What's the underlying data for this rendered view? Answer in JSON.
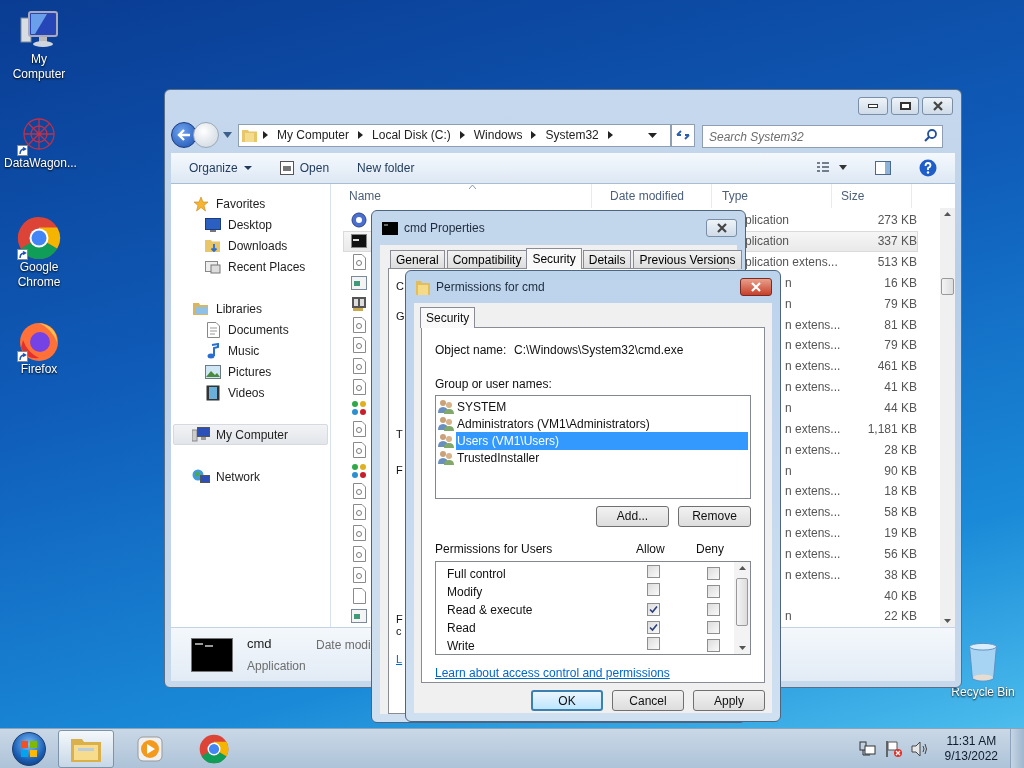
{
  "desktop_icons": [
    {
      "label": "My Computer",
      "kind": "computer",
      "shortcut": false
    },
    {
      "label": "DataWagon...",
      "kind": "datawagon",
      "shortcut": true
    },
    {
      "label": "Google Chrome",
      "kind": "chrome",
      "shortcut": true
    },
    {
      "label": "Firefox",
      "kind": "firefox",
      "shortcut": true
    },
    {
      "label": "Recycle Bin",
      "kind": "recycle",
      "shortcut": false
    }
  ],
  "explorer": {
    "breadcrumb": [
      "My Computer",
      "Local Disk (C:)",
      "Windows",
      "System32"
    ],
    "search": {
      "placeholder": "Search System32"
    },
    "toolbar": [
      {
        "label": "Organize",
        "kind": "menu"
      },
      {
        "label": "Open",
        "kind": "open"
      },
      {
        "label": "New folder",
        "kind": "plain"
      }
    ],
    "nav": [
      {
        "label": "Favorites",
        "selected": false,
        "children": [
          {
            "label": "Desktop",
            "selected": false
          },
          {
            "label": "Downloads",
            "selected": false
          },
          {
            "label": "Recent Places",
            "selected": false
          }
        ]
      },
      {
        "label": "Libraries",
        "selected": false,
        "children": [
          {
            "label": "Documents",
            "selected": false
          },
          {
            "label": "Music",
            "selected": false
          },
          {
            "label": "Pictures",
            "selected": false
          },
          {
            "label": "Videos",
            "selected": false
          }
        ]
      },
      {
        "label": "My Computer",
        "selected": true
      },
      {
        "label": "Network",
        "selected": false
      }
    ],
    "columns": [
      "Name",
      "Date modified",
      "Type",
      "Size"
    ],
    "rows": [
      {
        "kind": "globe",
        "type": "plication",
        "size": "273 KB",
        "selected": false
      },
      {
        "kind": "cmd",
        "type": "plication",
        "size": "337 KB",
        "selected": true
      },
      {
        "kind": "dll",
        "type": "plication extens...",
        "size": "513 KB",
        "selected": false
      },
      {
        "kind": "window",
        "type": "n",
        "size": "16 KB",
        "selected": false
      },
      {
        "kind": "book",
        "type": "n",
        "size": "79 KB",
        "selected": false
      },
      {
        "kind": "dll",
        "type": "n extens...",
        "size": "81 KB",
        "selected": false
      },
      {
        "kind": "dll",
        "type": "n extens...",
        "size": "79 KB",
        "selected": false
      },
      {
        "kind": "dll",
        "type": "n extens...",
        "size": "461 KB",
        "selected": false
      },
      {
        "kind": "dll",
        "type": "n extens...",
        "size": "41 KB",
        "selected": false
      },
      {
        "kind": "flower",
        "type": "n",
        "size": "44 KB",
        "selected": false
      },
      {
        "kind": "dll",
        "type": "n extens...",
        "size": "1,181 KB",
        "selected": false
      },
      {
        "kind": "dll",
        "type": "n extens...",
        "size": "28 KB",
        "selected": false
      },
      {
        "kind": "flower",
        "type": "n",
        "size": "90 KB",
        "selected": false
      },
      {
        "kind": "dll",
        "type": "n extens...",
        "size": "18 KB",
        "selected": false
      },
      {
        "kind": "dll",
        "type": "n extens...",
        "size": "58 KB",
        "selected": false
      },
      {
        "kind": "dll",
        "type": "n extens...",
        "size": "19 KB",
        "selected": false
      },
      {
        "kind": "dll",
        "type": "n extens...",
        "size": "56 KB",
        "selected": false
      },
      {
        "kind": "dll",
        "type": "n extens...",
        "size": "38 KB",
        "selected": false
      },
      {
        "kind": "blank",
        "size": "40 KB",
        "selected": false
      },
      {
        "kind": "window",
        "type": "n",
        "size": "22 KB",
        "selected": false
      }
    ],
    "details": {
      "name": "cmd",
      "type": "Application",
      "label": "Date modi"
    }
  },
  "properties": {
    "title": "cmd Properties",
    "tabs": [
      {
        "label": "General",
        "selected": false
      },
      {
        "label": "Compatibility",
        "selected": false
      },
      {
        "label": "Security",
        "selected": true
      },
      {
        "label": "Details",
        "selected": false
      },
      {
        "label": "Previous Versions",
        "selected": false
      }
    ],
    "fragments": [
      {
        "text": "C",
        "kind": "text"
      },
      {
        "text": "G",
        "kind": "text"
      },
      {
        "text": "T",
        "kind": "text"
      },
      {
        "text": "F",
        "kind": "text"
      },
      {
        "text": "F",
        "kind": "text"
      },
      {
        "text": "c",
        "kind": "text"
      },
      {
        "text": "L",
        "kind": "link"
      }
    ]
  },
  "permissions": {
    "title": "Permissions for cmd",
    "tabs": [
      {
        "label": "Security",
        "selected": true
      }
    ],
    "object_label": "Object name:",
    "object_value": "C:\\Windows\\System32\\cmd.exe",
    "groups_label": "Group or user names:",
    "groups": [
      {
        "name": "SYSTEM",
        "selected": false
      },
      {
        "name": "Administrators (VM1\\Administrators)",
        "selected": false
      },
      {
        "name": "Users (VM1\\Users)",
        "selected": true
      },
      {
        "name": "TrustedInstaller",
        "selected": false
      }
    ],
    "group_buttons": [
      "Add...",
      "Remove"
    ],
    "perm_label": "Permissions for Users",
    "allow_label": "Allow",
    "deny_label": "Deny",
    "permissions": [
      {
        "name": "Full control",
        "allow": false,
        "deny": false
      },
      {
        "name": "Modify",
        "allow": false,
        "deny": false
      },
      {
        "name": "Read & execute",
        "allow": true,
        "deny": false
      },
      {
        "name": "Read",
        "allow": true,
        "deny": false
      },
      {
        "name": "Write",
        "allow": false,
        "deny": false
      }
    ],
    "link": "Learn about access control and permissions",
    "buttons": [
      {
        "label": "OK",
        "default": true
      },
      {
        "label": "Cancel",
        "default": false
      },
      {
        "label": "Apply",
        "default": false
      }
    ]
  },
  "taskbar": {
    "pinned": [
      {
        "kind": "explorer",
        "active": true
      },
      {
        "kind": "media",
        "active": false
      },
      {
        "kind": "chrome",
        "active": false
      }
    ],
    "time": "11:31 AM",
    "date": "9/13/2022"
  }
}
